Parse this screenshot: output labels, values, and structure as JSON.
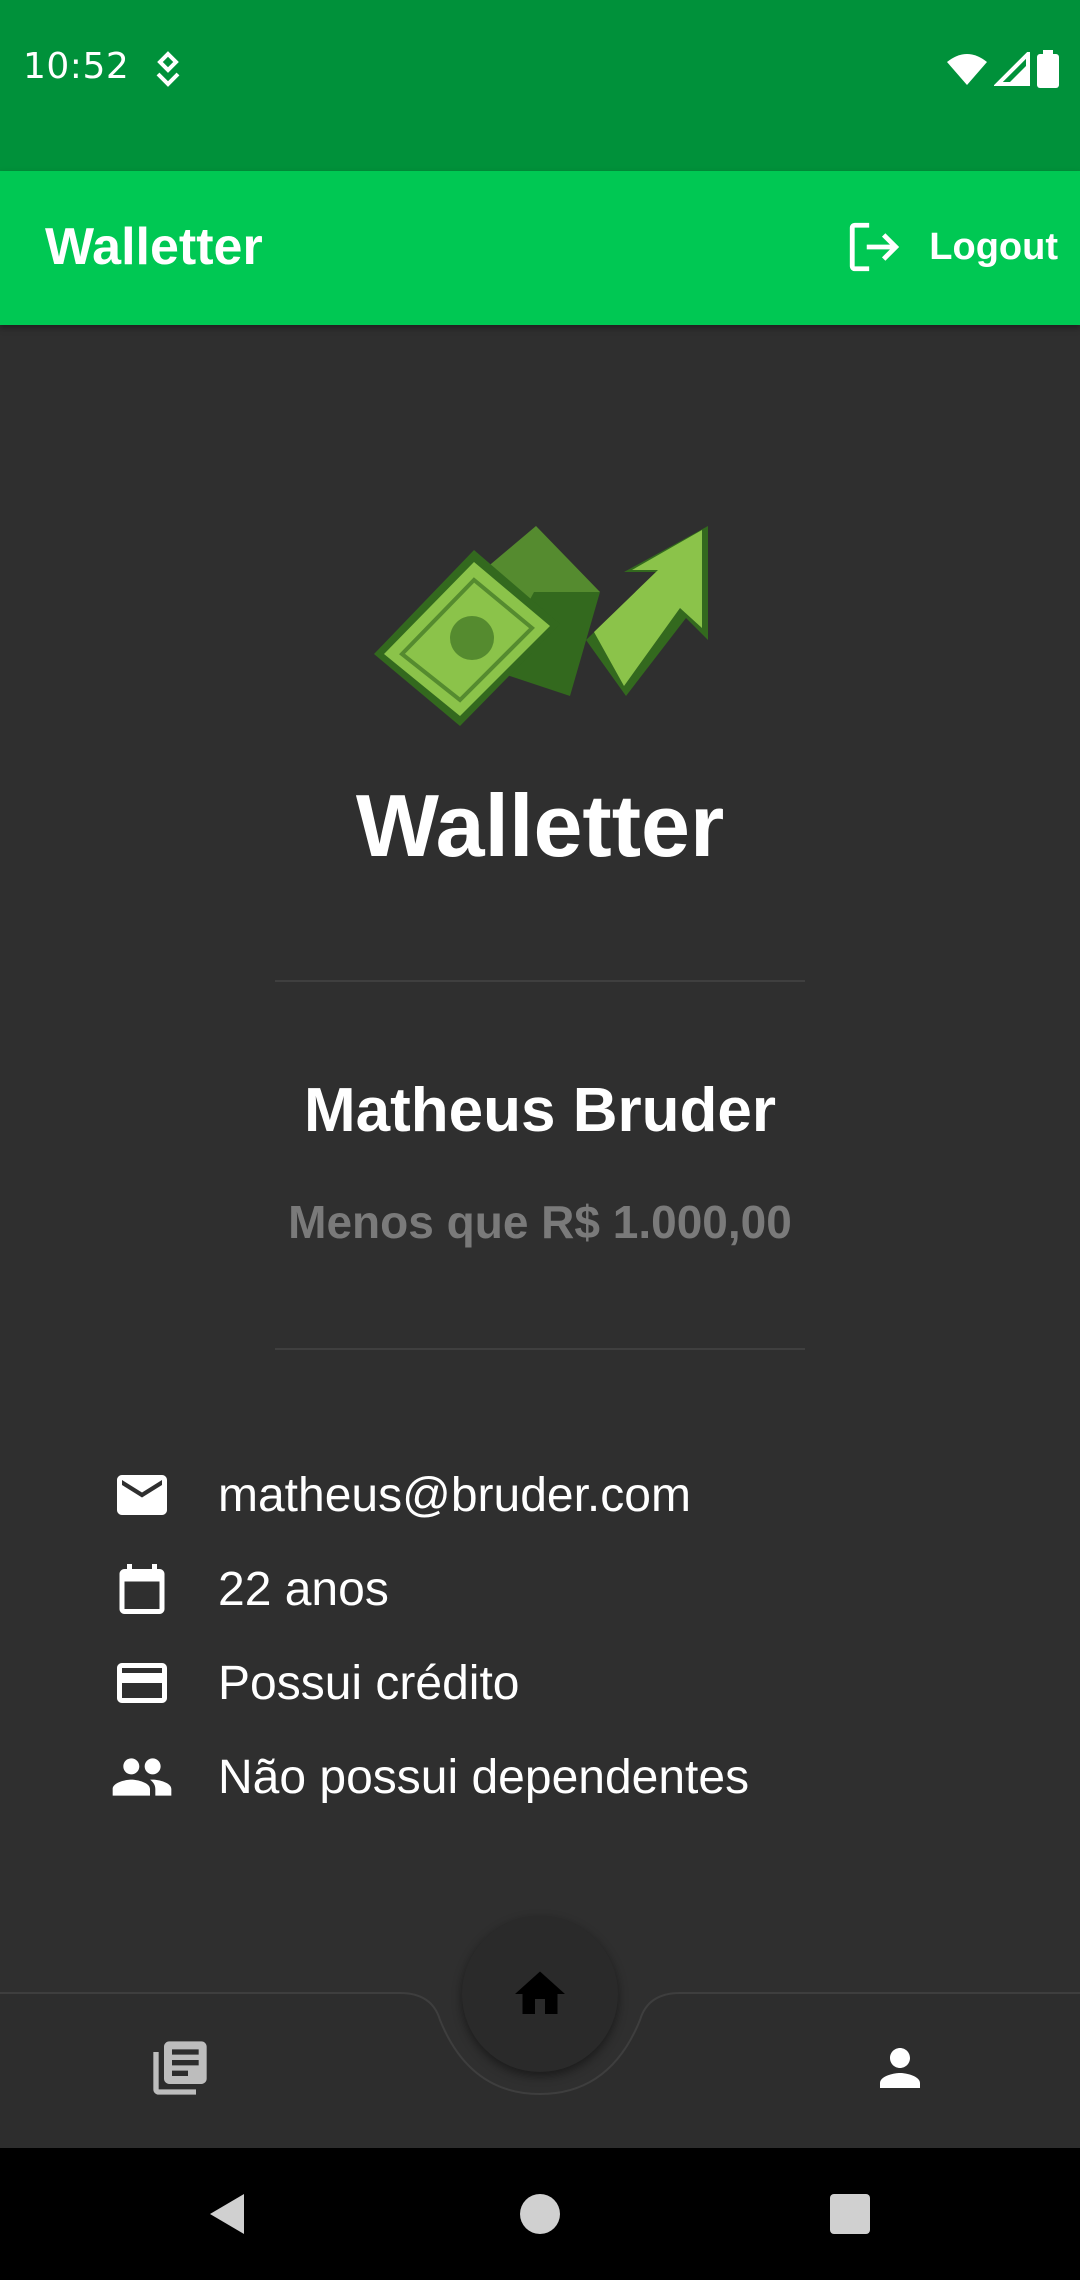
{
  "status_bar": {
    "time": "10:52",
    "icons": [
      "notification-icon",
      "wifi-icon",
      "signal-icon",
      "battery-icon"
    ]
  },
  "app_bar": {
    "title": "Walletter",
    "logout_label": "Logout",
    "logout_icon": "logout-icon"
  },
  "profile": {
    "brand_name": "Walletter",
    "logo": "money-growth-logo",
    "user_name": "Matheus Bruder",
    "income": "Menos que R$ 1.000,00"
  },
  "info": [
    {
      "icon": "mail-icon",
      "text": "matheus@bruder.com"
    },
    {
      "icon": "calendar-icon",
      "text": "22 anos"
    },
    {
      "icon": "credit-card-icon",
      "text": "Possui crédito"
    },
    {
      "icon": "people-icon",
      "text": "Não possui dependentes"
    }
  ],
  "bottom_nav": {
    "left_icon": "news-icon",
    "center_icon": "home-icon",
    "right_icon": "person-icon"
  },
  "colors": {
    "status_bar": "#00913a",
    "app_bar": "#00c853",
    "background": "#2f2f2f",
    "muted_text": "#7a7a7a",
    "logo_green_light": "#8bc34a",
    "logo_green_dark": "#33691e"
  }
}
